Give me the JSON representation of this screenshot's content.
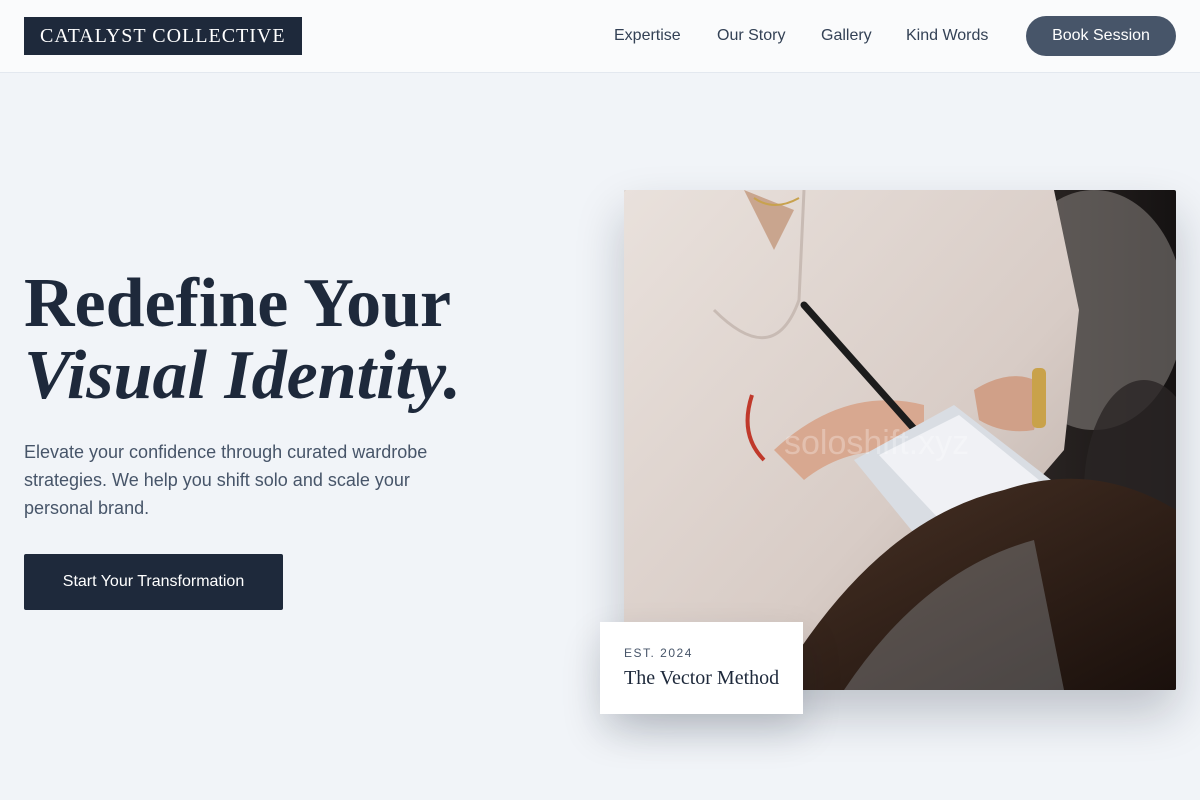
{
  "header": {
    "logo": "CATALYST COLLECTIVE",
    "nav": [
      "Expertise",
      "Our Story",
      "Gallery",
      "Kind Words"
    ],
    "book_label": "Book Session"
  },
  "hero": {
    "headline_line1": "Redefine Your",
    "headline_line2": "Visual Identity.",
    "subtext": "Elevate your confidence through curated wardrobe strategies. We help you shift solo and scale your personal brand.",
    "cta_label": "Start Your Transformation"
  },
  "photo": {
    "subject": "hair-colorist-applying-dye",
    "watermark": "soloshift.xyz"
  },
  "badge": {
    "est": "EST. 2024",
    "title": "The Vector Method"
  },
  "colors": {
    "page_bg": "#f1f4f8",
    "primary": "#1e293b",
    "accent": "#475569"
  }
}
